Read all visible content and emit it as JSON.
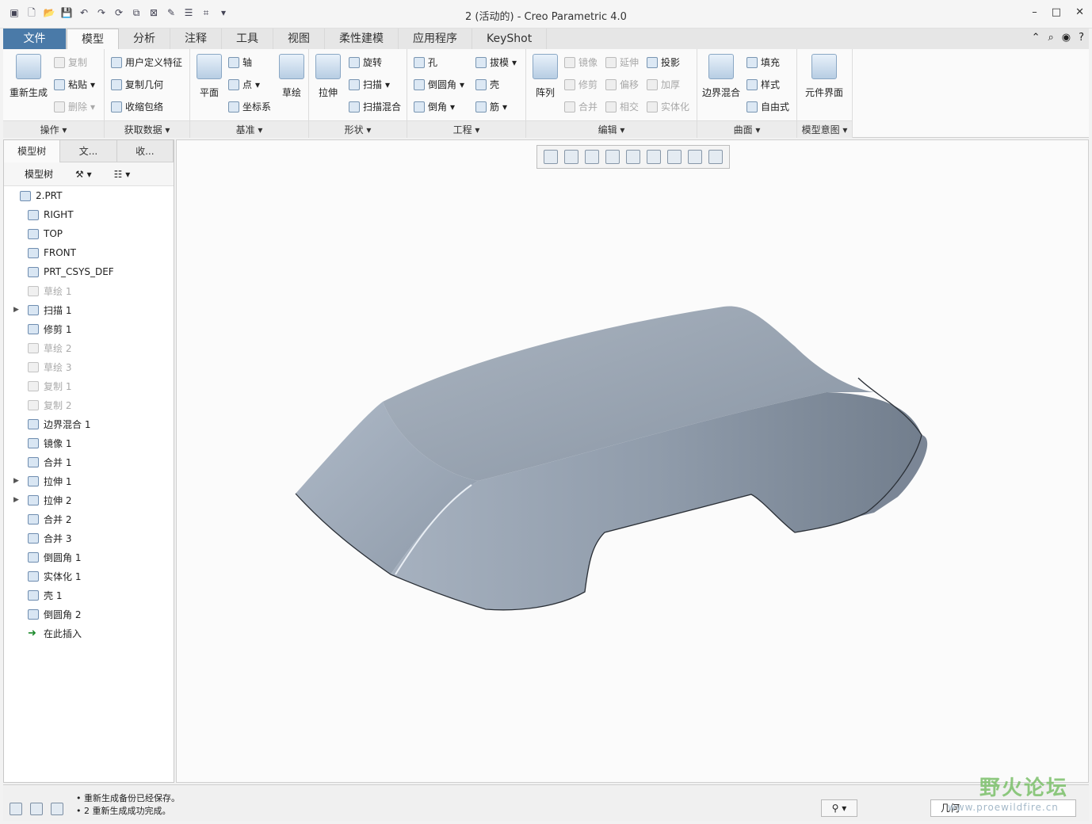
{
  "window": {
    "title": "2 (活动的) - Creo Parametric 4.0"
  },
  "tabs": [
    "文件",
    "模型",
    "分析",
    "注释",
    "工具",
    "视图",
    "柔性建模",
    "应用程序",
    "KeyShot"
  ],
  "ribbon": {
    "ops": {
      "label": "操作",
      "regen": "重新生成",
      "copy": "复制",
      "paste": "粘贴",
      "delete": "删除"
    },
    "getdata": {
      "label": "获取数据",
      "udf": "用户定义特征",
      "copygeom": "复制几何",
      "shrink": "收缩包络"
    },
    "datum": {
      "label": "基准",
      "plane": "平面",
      "axis": "轴",
      "point": "点",
      "csys": "坐标系",
      "sketch": "草绘"
    },
    "shape": {
      "label": "形状",
      "extrude": "拉伸",
      "revolve": "旋转",
      "sweep": "扫描",
      "swept_blend": "扫描混合"
    },
    "eng": {
      "label": "工程",
      "hole": "孔",
      "round": "倒圆角",
      "chamfer": "倒角",
      "draft": "拔模",
      "shell": "壳",
      "rib": "筋"
    },
    "edit": {
      "label": "编辑",
      "pattern": "阵列",
      "mirror": "镜像",
      "trim": "修剪",
      "merge": "合并",
      "extend": "延伸",
      "offset": "偏移",
      "intersect": "相交",
      "project": "投影",
      "thicken": "加厚",
      "solidify": "实体化"
    },
    "surface": {
      "label": "曲面",
      "boundary": "边界混合",
      "fill": "填充",
      "style": "样式",
      "freestyle": "自由式"
    },
    "intent": {
      "label": "模型意图",
      "component_interface": "元件界面"
    }
  },
  "panel": {
    "tabs": [
      "模型树",
      "文...",
      "收..."
    ],
    "toolbar_title": "模型树",
    "tree": [
      {
        "label": "2.PRT",
        "state": "root"
      },
      {
        "label": "RIGHT",
        "state": "normal"
      },
      {
        "label": "TOP",
        "state": "normal"
      },
      {
        "label": "FRONT",
        "state": "normal"
      },
      {
        "label": "PRT_CSYS_DEF",
        "state": "normal"
      },
      {
        "label": "草绘 1",
        "state": "dim"
      },
      {
        "label": "扫描 1",
        "state": "expandable"
      },
      {
        "label": "修剪 1",
        "state": "normal"
      },
      {
        "label": "草绘 2",
        "state": "dim"
      },
      {
        "label": "草绘 3",
        "state": "dim"
      },
      {
        "label": "复制 1",
        "state": "dim"
      },
      {
        "label": "复制 2",
        "state": "dim"
      },
      {
        "label": "边界混合 1",
        "state": "normal"
      },
      {
        "label": "镜像 1",
        "state": "normal"
      },
      {
        "label": "合并 1",
        "state": "normal"
      },
      {
        "label": "拉伸 1",
        "state": "expandable"
      },
      {
        "label": "拉伸 2",
        "state": "expandable"
      },
      {
        "label": "合并 2",
        "state": "normal"
      },
      {
        "label": "合并 3",
        "state": "normal"
      },
      {
        "label": "倒圆角 1",
        "state": "normal"
      },
      {
        "label": "实体化 1",
        "state": "normal"
      },
      {
        "label": "壳 1",
        "state": "normal"
      },
      {
        "label": "倒圆角 2",
        "state": "normal"
      },
      {
        "label": "在此插入",
        "state": "insert"
      }
    ]
  },
  "status": {
    "messages": [
      "• 重新生成备份已经保存。",
      "• 2 重新生成成功完成。"
    ],
    "filter": "几何"
  },
  "watermark": {
    "text": "野火论坛",
    "url": "www.proewildfire.cn"
  },
  "colors": {
    "file_tab": "#4a7aa8",
    "model_surface": "#9aa6b4"
  }
}
